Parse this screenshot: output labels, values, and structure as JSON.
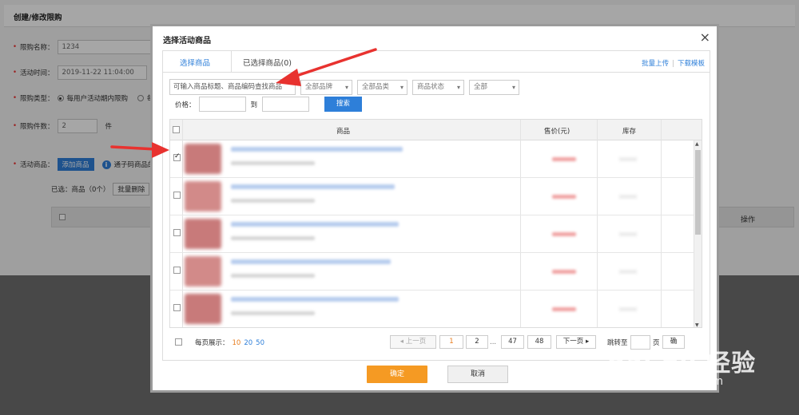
{
  "background_page": {
    "title": "创建/修改限购",
    "name_label": "限购名称：",
    "name_value": "1234",
    "time_label": "活动时间：",
    "time_value": "2019-11-22 11:04:00",
    "time_to": "至",
    "type_label": "限购类型：",
    "type_option": "每用户活动期内限购",
    "type_option2_partial": "每",
    "count_label": "限购件数：",
    "count_value": "2",
    "count_unit": "件",
    "goods_label": "活动商品：",
    "add_goods_button": "添加商品",
    "info_text_partial": "通子码商品的",
    "selected_text": "已选：商品（0个）",
    "batch_delete_button": "批量删除",
    "table_op_header": "操作"
  },
  "modal": {
    "title": "选择活动商品",
    "close_glyph": "×",
    "tabs": [
      {
        "label": "选择商品",
        "active": true
      },
      {
        "label": "已选择商品(0)",
        "active": false
      }
    ],
    "links": {
      "batch_upload": "批量上传",
      "separator": "|",
      "download_template": "下载模板"
    },
    "filters": {
      "search_placeholder": "可输入商品标题、商品编码查找商品",
      "brand": "全部品牌",
      "category": "全部品类",
      "status": "商品状态",
      "all": "全部"
    },
    "price_label": "价格：",
    "price_to": "到",
    "search_button": "搜索",
    "table": {
      "columns": [
        "商品",
        "售价(元)",
        "库存"
      ],
      "rows": [
        {
          "checked": true
        },
        {
          "checked": false
        },
        {
          "checked": false
        },
        {
          "checked": false
        },
        {
          "checked": false
        }
      ]
    },
    "pager": {
      "per_page_label": "每页展示：",
      "per_page_options": [
        "10",
        "20",
        "50"
      ],
      "per_page_current": "10",
      "prev": "上一页",
      "pages": [
        "1",
        "2",
        "47",
        "48"
      ],
      "ellipsis": "...",
      "current_page": "1",
      "next": "下一页",
      "jump_label": "跳转至",
      "page_unit": "页",
      "jump_button_partial": "确"
    },
    "ok_button": "确定",
    "cancel_button": "取消"
  },
  "watermark": {
    "main": "Bai du 经验",
    "sub": "jingyan.baidu.com"
  },
  "colors": {
    "accent_blue": "#2e7fd9",
    "confirm_orange": "#f59a23",
    "annotation_red": "#e8322f",
    "page_current": "#e87d1e"
  }
}
